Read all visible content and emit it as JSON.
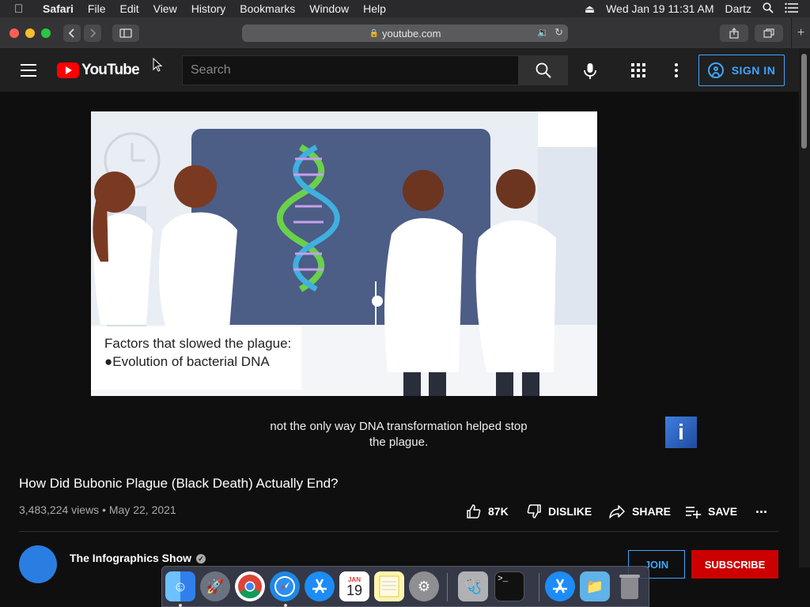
{
  "menubar": {
    "app": "Safari",
    "items": [
      "File",
      "Edit",
      "View",
      "History",
      "Bookmarks",
      "Window",
      "Help"
    ],
    "datetime": "Wed Jan 19  11:31 AM",
    "user": "Dartz"
  },
  "browser": {
    "url": "youtube.com"
  },
  "youtube": {
    "logo_text": "YouTube",
    "search_placeholder": "Search",
    "signin_label": "SIGN IN"
  },
  "video": {
    "overlay_line1": "Factors that slowed the plague:",
    "overlay_line2": "●Evolution of bacterial DNA",
    "subtitle": "not the only way DNA transformation helped stop the plague.",
    "info_card": "i",
    "title": "How Did Bubonic Plague (Black Death) Actually End?",
    "views": "3,483,224 views",
    "date": "May 22, 2021",
    "like_count": "87K",
    "dislike_label": "DISLIKE",
    "share_label": "SHARE",
    "save_label": "SAVE",
    "more_label": "..."
  },
  "channel": {
    "name": "The Infographics Show",
    "join_label": "JOIN",
    "subscribe_label": "SUBSCRIBE"
  },
  "dock": {
    "calendar_month": "JAN",
    "calendar_day": "19"
  },
  "colors": {
    "accent_blue": "#3ea6ff",
    "youtube_red": "#ff0000",
    "subscribe_red": "#cc0000",
    "background": "#0f0f0f"
  }
}
